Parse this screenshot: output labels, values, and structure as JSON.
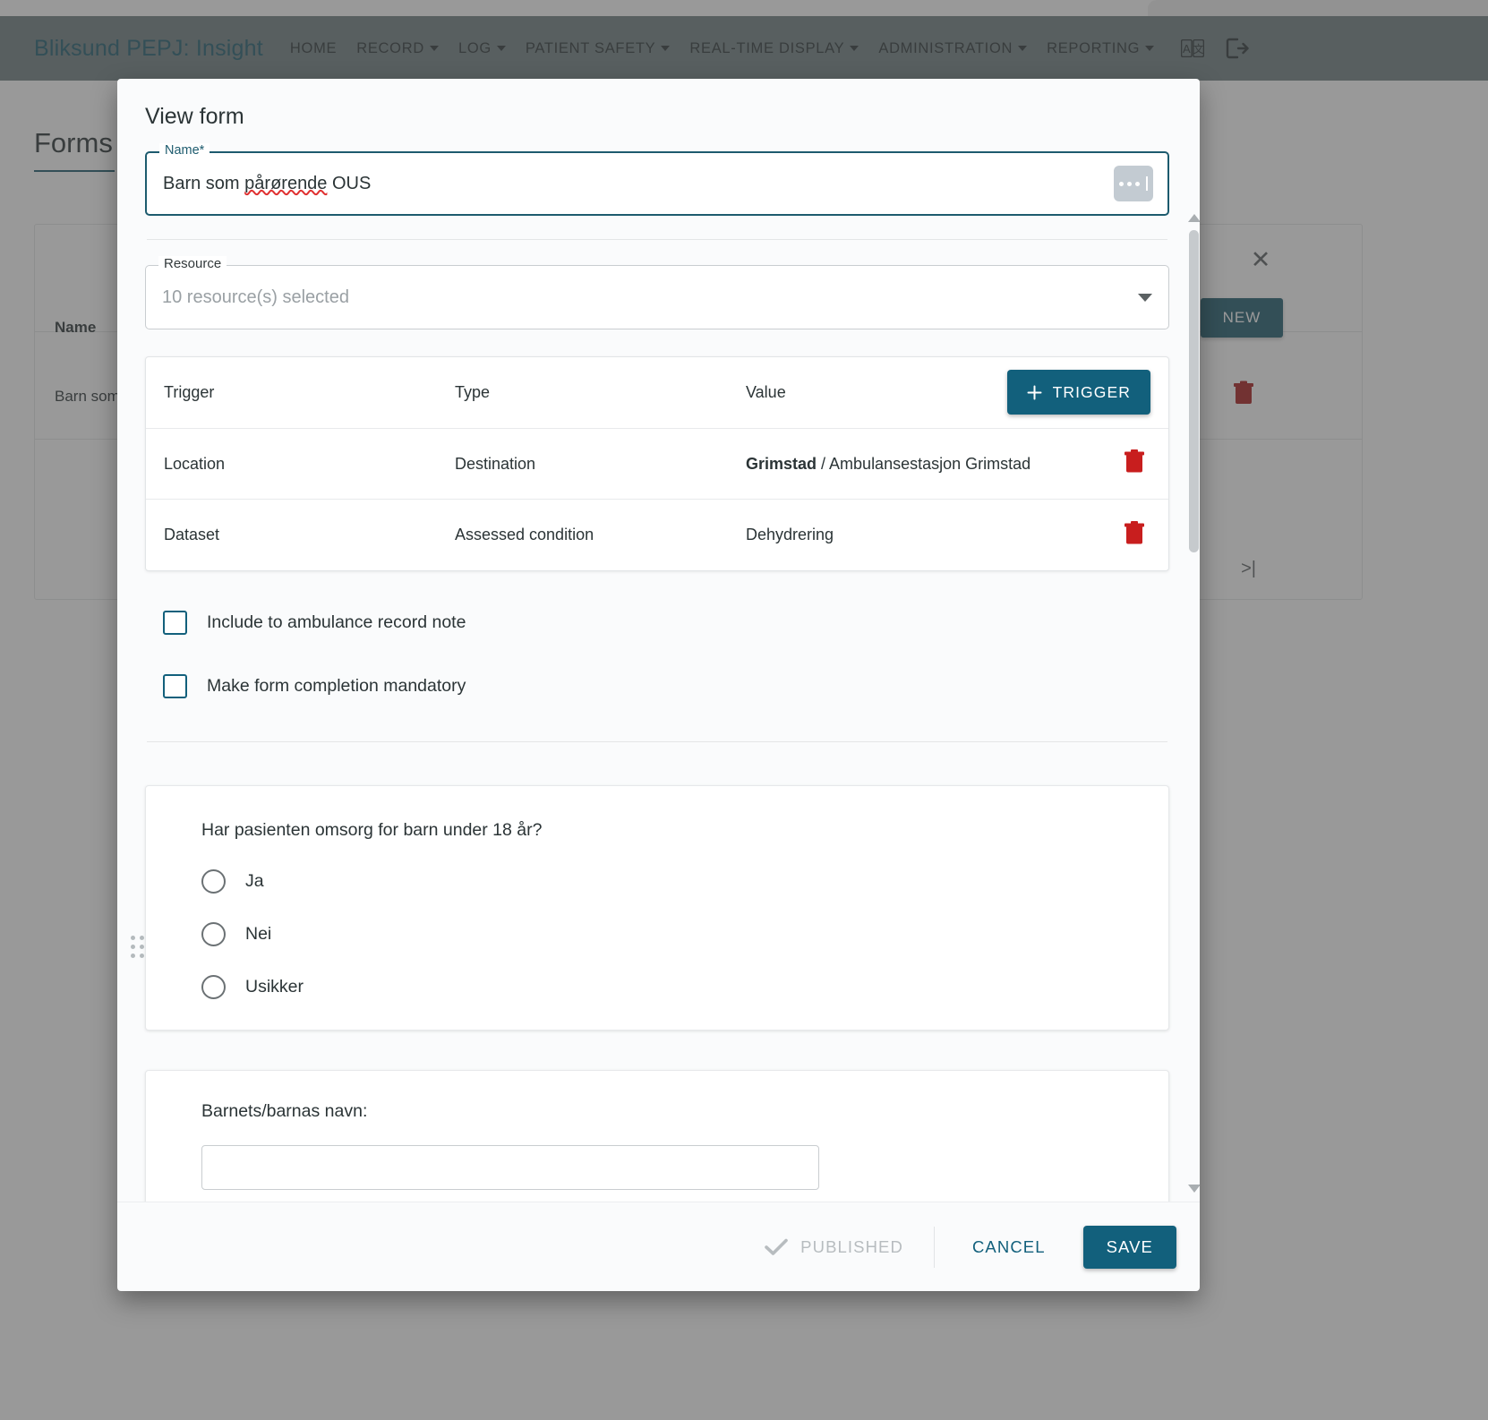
{
  "navbar": {
    "brand": "Bliksund PEPJ: Insight",
    "items": [
      {
        "label": "HOME",
        "has_caret": false
      },
      {
        "label": "RECORD",
        "has_caret": true
      },
      {
        "label": "LOG",
        "has_caret": true
      },
      {
        "label": "PATIENT SAFETY",
        "has_caret": true
      },
      {
        "label": "REAL-TIME DISPLAY",
        "has_caret": true
      },
      {
        "label": "ADMINISTRATION",
        "has_caret": true
      },
      {
        "label": "REPORTING",
        "has_caret": true
      }
    ],
    "translate_icon": "translate-icon",
    "logout_icon": "logout-icon",
    "background_color": "#6f7f80",
    "brand_color": "#1d5b6e"
  },
  "background": {
    "page_title": "Forms",
    "close_icon": "close-icon",
    "new_button": "NEW",
    "table_header_name": "Name",
    "row_name": "Barn som",
    "delete_icon": "trash-icon",
    "pager_last_icon": "last-page-icon",
    "accent": "#1d5b6e",
    "danger": "#a81b1b"
  },
  "modal": {
    "title": "View form",
    "name_field": {
      "label": "Name*",
      "value": "Barn som ",
      "value_misspelled": "pårørende",
      "value_tail": " OUS",
      "ellipsis_icon": "ellipsis-icon",
      "border_color": "#1d5b6e"
    },
    "resource_field": {
      "label": "Resource",
      "value": "10 resource(s) selected",
      "dropdown_icon": "chevron-down-icon"
    },
    "triggers": {
      "columns": [
        "Trigger",
        "Type",
        "Value"
      ],
      "add_button": "TRIGGER",
      "add_icon": "plus-icon",
      "delete_icon": "trash-icon",
      "rows": [
        {
          "trigger": "Location",
          "type": "Destination",
          "value_bold": "Grimstad",
          "value_rest": " / Ambulansestasjon Grimstad"
        },
        {
          "trigger": "Dataset",
          "type": "Assessed condition",
          "value_bold": "",
          "value_rest": "Dehydrering"
        }
      ]
    },
    "checkboxes": [
      {
        "label": "Include to ambulance record note",
        "checked": false
      },
      {
        "label": "Make form completion mandatory",
        "checked": false
      }
    ],
    "questions": [
      {
        "text": "Har pasienten omsorg for barn under 18 år?",
        "type": "radio",
        "options": [
          "Ja",
          "Nei",
          "Usikker"
        ],
        "drag_handle_icon": "drag-handle-icon"
      },
      {
        "text": "Barnets/barnas navn:",
        "type": "text",
        "options": []
      }
    ],
    "footer": {
      "published_label": "PUBLISHED",
      "published_icon": "check-icon",
      "published_enabled": false,
      "cancel_label": "CANCEL",
      "save_label": "SAVE",
      "accent": "#12607c"
    },
    "scrollbar": {
      "up_icon": "scroll-up-icon",
      "down_icon": "scroll-down-icon"
    }
  }
}
